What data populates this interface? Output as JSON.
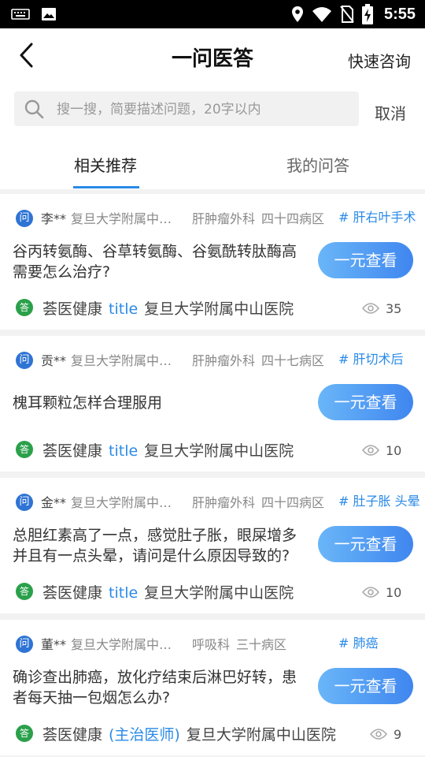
{
  "status_bar": {
    "time": "5:55"
  },
  "header": {
    "title": "一问医答",
    "quick_consult": "快速咨询"
  },
  "search": {
    "placeholder": "搜一搜，简要描述问题，20字以内",
    "cancel": "取消"
  },
  "tabs": [
    {
      "label": "相关推荐",
      "active": true
    },
    {
      "label": "我的问答",
      "active": false
    }
  ],
  "badges": {
    "question": "问",
    "answer": "答"
  },
  "view_button_label": "一元查看",
  "cards": [
    {
      "name": "李**",
      "hospital": "复旦大学附属中山医院",
      "dept": "肝肿瘤外科",
      "ward": "四十四病区",
      "tag": "# 肝右叶手术",
      "question": "谷丙转氨酶、谷草转氨酶、谷氨酰转肽酶高需要怎么治疗?",
      "answer_source": "荟医健康",
      "answer_title": "title",
      "answer_hospital": "复旦大学附属中山医院",
      "views": "35"
    },
    {
      "name": "贡**",
      "hospital": "复旦大学附属中山医院",
      "dept": "肝肿瘤外科",
      "ward": "四十七病区",
      "tag": "# 肝切术后",
      "question": "槐耳颗粒怎样合理服用",
      "answer_source": "荟医健康",
      "answer_title": "title",
      "answer_hospital": "复旦大学附属中山医院",
      "views": "10"
    },
    {
      "name": "金**",
      "hospital": "复旦大学附属中山医院",
      "dept": "肝肿瘤外科",
      "ward": "四十四病区",
      "tag": "# 肚子胀 头晕",
      "question": "总胆红素高了一点，感觉肚子胀，眼屎增多并且有一点头晕，请问是什么原因导致的?",
      "answer_source": "荟医健康",
      "answer_title": "title",
      "answer_hospital": "复旦大学附属中山医院",
      "views": "10"
    },
    {
      "name": "董**",
      "hospital": "复旦大学附属中山医院",
      "dept": "呼吸科",
      "ward": "三十病区",
      "tag": "# 肺癌",
      "question": "确诊查出肺癌，放化疗结束后淋巴好转，患者每天抽一包烟怎么办?",
      "answer_source": "荟医健康",
      "answer_title": "(主治医师)",
      "answer_hospital": "复旦大学附属中山医院",
      "views": "9"
    }
  ]
}
